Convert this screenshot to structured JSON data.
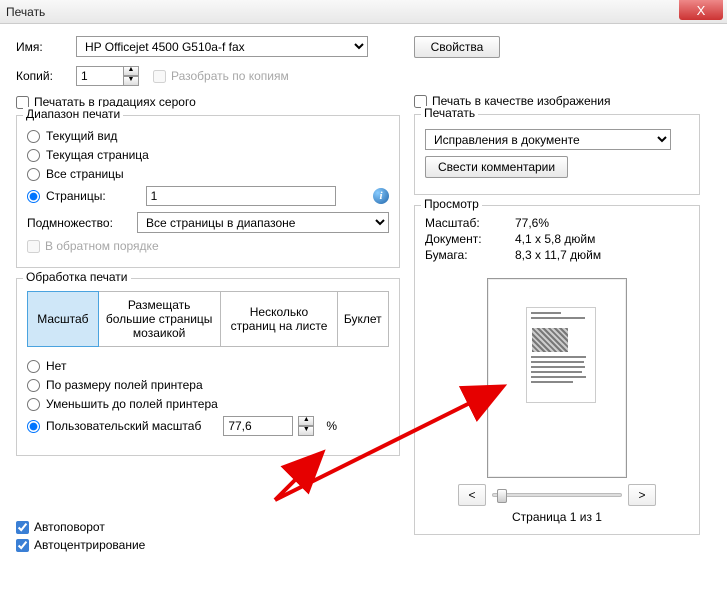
{
  "titlebar": {
    "title": "Печать",
    "close": "X"
  },
  "name": {
    "label": "Имя:",
    "printer": "HP Officejet 4500 G510a-f fax"
  },
  "properties_btn": "Свойства",
  "copies": {
    "label": "Копий:",
    "value": "1"
  },
  "collate_label": "Разобрать по копиям",
  "grayscale_label": "Печатать в градациях серого",
  "as_image_label": "Печать в качестве изображения",
  "range": {
    "legend": "Диапазон печати",
    "current_view": "Текущий вид",
    "current_page": "Текущая страница",
    "all_pages": "Все страницы",
    "pages": "Страницы:",
    "pages_value": "1",
    "subset_label": "Подмножество:",
    "subset_value": "Все страницы в диапазоне",
    "reverse": "В обратном порядке"
  },
  "handling": {
    "legend": "Обработка печати",
    "tabs": [
      "Масштаб",
      "Размещать большие страницы мозаикой",
      "Несколько страниц на листе",
      "Буклет"
    ],
    "none": "Нет",
    "fit": "По размеру полей принтера",
    "shrink": "Уменьшить до полей принтера",
    "custom": "Пользовательский масштаб",
    "custom_value": "77,6",
    "pct": "%"
  },
  "auto": {
    "autorotate": "Автоповорот",
    "autocenter": "Автоцентрирование"
  },
  "print_section": {
    "legend": "Печатать",
    "what": "Исправления в документе",
    "flatten": "Свести комментарии"
  },
  "preview": {
    "legend": "Просмотр",
    "zoom_label": "Масштаб:",
    "zoom_value": "77,6%",
    "doc_label": "Документ:",
    "doc_value": "4,1 x 5,8 дюйм",
    "paper_label": "Бумага:",
    "paper_value": "8,3 x 11,7 дюйм",
    "nav_prev": "<",
    "nav_next": ">",
    "page_of": "Страница 1 из 1"
  }
}
